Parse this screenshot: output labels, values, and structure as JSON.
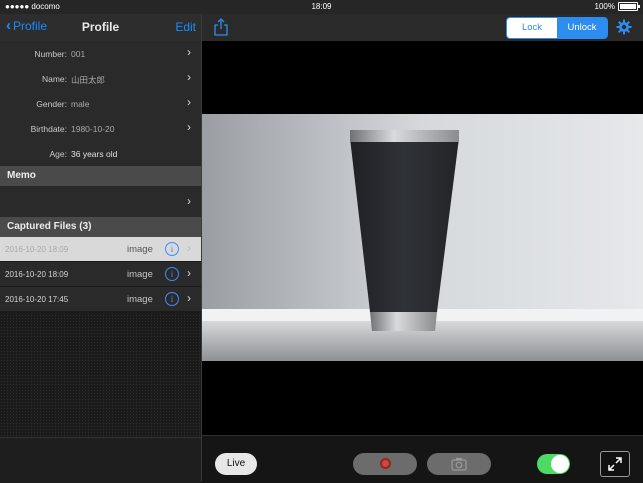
{
  "status": {
    "carrier": "●●●●● docomo",
    "time": "18:09",
    "battery": "100%"
  },
  "nav": {
    "back_label": "Profile",
    "title": "Profile",
    "edit_label": "Edit"
  },
  "profile": {
    "number": {
      "label": "Number:",
      "value": "001"
    },
    "name": {
      "label": "Name:",
      "value": "山田太郎"
    },
    "gender": {
      "label": "Gender:",
      "value": "male"
    },
    "birthdate": {
      "label": "Birthdate:",
      "value": "1980-10-20"
    },
    "age": {
      "label": "Age:",
      "value": "36 years old"
    }
  },
  "memo": {
    "header": "Memo"
  },
  "files": {
    "header": "Captured Files (3)",
    "items": [
      {
        "date": "2016-10-20 18:09",
        "type": "image"
      },
      {
        "date": "2016-10-20 18:09",
        "type": "image"
      },
      {
        "date": "2016-10-20 17:45",
        "type": "image"
      }
    ]
  },
  "toolbar": {
    "lock_label": "Lock",
    "unlock_label": "Unlock"
  },
  "controls": {
    "live_label": "Live",
    "toggle_on": true
  },
  "colors": {
    "accent": "#2d8cf0",
    "toggle": "#4cd964",
    "record": "#d4453a"
  },
  "icons": [
    "share-icon",
    "gear-icon",
    "record-icon",
    "camera-icon",
    "expand-icon",
    "chevron-right-icon",
    "info-icon",
    "chevron-left-icon"
  ]
}
